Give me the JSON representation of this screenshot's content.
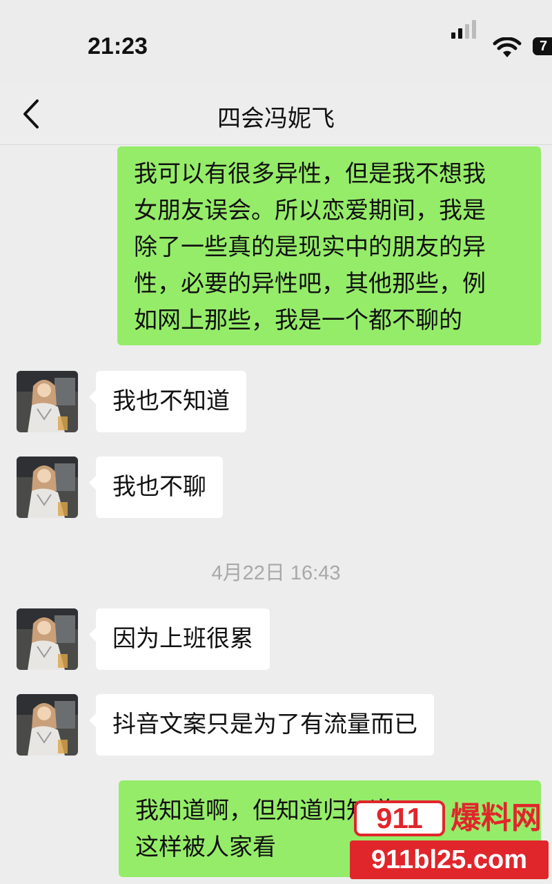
{
  "status_bar": {
    "time": "21:23",
    "battery": "7"
  },
  "header": {
    "title": "四会冯妮飞"
  },
  "messages": [
    {
      "side": "out",
      "lines": [
        "我可以有很多异性，但是我不想我",
        "女朋友误会。所以恋爱期间，我是",
        "除了一些真的是现实中的朋友的异",
        "性，必要的异性吧，其他那些，例",
        "如网上那些，我是一个都不聊的"
      ]
    },
    {
      "side": "in",
      "text": "我也不知道"
    },
    {
      "side": "in",
      "text": "我也不聊"
    },
    {
      "side": "in",
      "text": "因为上班很累"
    },
    {
      "side": "in",
      "text": "抖音文案只是为了有流量而已"
    },
    {
      "side": "out",
      "lines": [
        "我知道啊，但知道归知道",
        "这样被人家看"
      ]
    }
  ],
  "timestamp": "4月22日 16:43",
  "watermark": {
    "badge": "911",
    "label": "爆料网",
    "url": "911bl25.com"
  },
  "colors": {
    "outgoing_bubble": "#95ec69",
    "incoming_bubble": "#ffffff",
    "background": "#ededed",
    "watermark_red": "#e0262b"
  }
}
